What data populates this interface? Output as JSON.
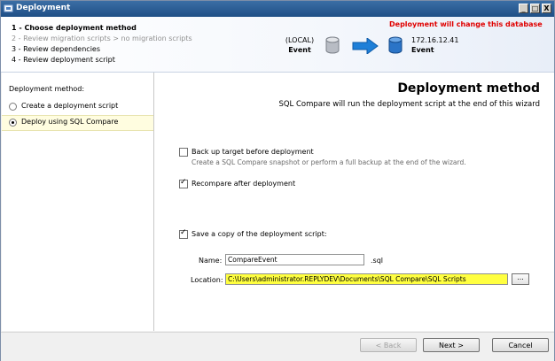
{
  "window": {
    "title": "Deployment"
  },
  "titlebar_buttons": {
    "minimize": "_",
    "maximize": "□",
    "close": "X"
  },
  "steps": [
    {
      "label": "1 - Choose deployment method",
      "state": "active"
    },
    {
      "label": "2 - Review migration scripts > no migration scripts",
      "state": "disabled"
    },
    {
      "label": "3 - Review dependencies",
      "state": "normal"
    },
    {
      "label": "4 - Review deployment script",
      "state": "normal"
    }
  ],
  "warning": "Deployment will change this database",
  "source": {
    "server": "(LOCAL)",
    "database": "Event"
  },
  "target": {
    "server": "172.16.12.41",
    "database": "Event"
  },
  "left_panel": {
    "title": "Deployment method:",
    "options": [
      {
        "label": "Create a deployment script",
        "selected": false
      },
      {
        "label": "Deploy using SQL Compare",
        "selected": true
      }
    ]
  },
  "main": {
    "title": "Deployment method",
    "subtitle": "SQL Compare will run the deployment script at the end of this wizard",
    "backup": {
      "label": "Back up target before deployment",
      "hint": "Create a SQL Compare snapshot or perform a full backup at the end of the wizard.",
      "checked": false
    },
    "recompare": {
      "label": "Recompare after deployment",
      "checked": true
    },
    "save_copy": {
      "label": "Save a copy of the deployment script:",
      "checked": true
    },
    "name_label": "Name:",
    "name_value": "CompareEvent",
    "name_suffix": ".sql",
    "location_label": "Location:",
    "location_value": "C:\\Users\\administrator.REPLYDEV\\Documents\\SQL Compare\\SQL Scripts",
    "browse_label": "..."
  },
  "footer": {
    "back": "< Back",
    "next": "Next >",
    "cancel": "Cancel"
  },
  "colors": {
    "warning": "#e00000",
    "highlight": "#ffff40",
    "arrow": "#1e7fd8"
  }
}
